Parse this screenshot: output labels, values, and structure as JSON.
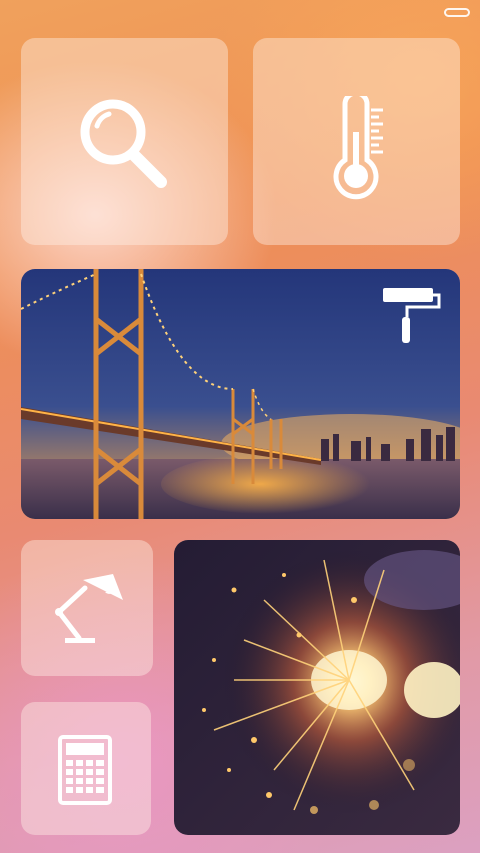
{
  "tiles": [
    {
      "id": "search",
      "icon": "search-icon"
    },
    {
      "id": "thermometer",
      "icon": "thermometer-icon"
    },
    {
      "id": "bridge-photo",
      "icon": "paint-roller-icon"
    },
    {
      "id": "lamp",
      "icon": "desk-lamp-icon"
    },
    {
      "id": "calculator",
      "icon": "calculator-icon"
    },
    {
      "id": "sparkler-photo",
      "icon": ""
    }
  ],
  "colors": {
    "tile_overlay": "#ffffff",
    "icon": "#ffffff",
    "sky_top": "#2b3f7a",
    "bridge_lights": "#ffb347"
  }
}
